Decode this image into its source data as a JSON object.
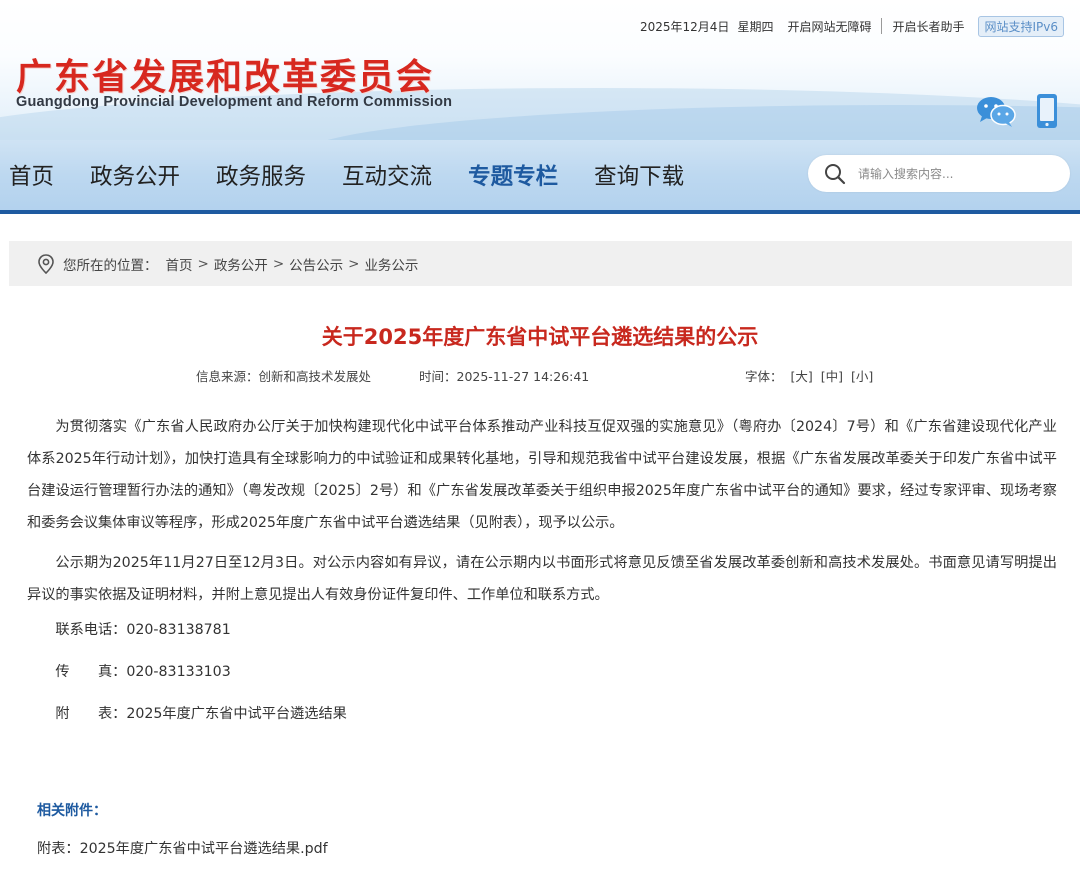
{
  "topbar": {
    "date": "2025年12月4日",
    "weekday": "星期四",
    "accessibility_label": "开启网站无障碍",
    "elder_label": "开启长者助手",
    "ipv6_label": "网站支持IPv6"
  },
  "logo": {
    "cn": "广东省发展和改革委员会",
    "en": "Guangdong Provincial Development and Reform Commission"
  },
  "nav": {
    "items": [
      {
        "label": "首页"
      },
      {
        "label": "政务公开"
      },
      {
        "label": "政务服务"
      },
      {
        "label": "互动交流"
      },
      {
        "label": "专题专栏"
      },
      {
        "label": "查询下载"
      }
    ],
    "active_index": 4
  },
  "search": {
    "placeholder": "请输入搜索内容..."
  },
  "breadcrumb": {
    "label": "您所在的位置：",
    "items": [
      "首页",
      "政务公开",
      "公告公示",
      "业务公示"
    ],
    "separator": ">"
  },
  "article": {
    "title": "关于2025年度广东省中试平台遴选结果的公示",
    "source": "信息来源：创新和高技术发展处",
    "time": "时间：2025-11-27 14:26:41",
    "font_label": "字体：",
    "font_large": "[大]",
    "font_medium": "[中]",
    "font_small": "[小]",
    "paragraphs": [
      "为贯彻落实《广东省人民政府办公厅关于加快构建现代化中试平台体系推动产业科技互促双强的实施意见》（粤府办〔2024〕7号）和《广东省建设现代化产业体系2025年行动计划》，加快打造具有全球影响力的中试验证和成果转化基地，引导和规范我省中试平台建设发展，根据《广东省发展改革委关于印发广东省中试平台建设运行管理暂行办法的通知》（粤发改规〔2025〕2号）和《广东省发展改革委关于组织申报2025年度广东省中试平台的通知》要求，经过专家评审、现场考察和委务会议集体审议等程序，形成2025年度广东省中试平台遴选结果（见附表），现予以公示。",
      "公示期为2025年11月27日至12月3日。对公示内容如有异议，请在公示期内以书面形式将意见反馈至省发展改革委创新和高技术发展处。书面意见请写明提出异议的事实依据及证明材料，并附上意见提出人有效身份证件复印件、工作单位和联系方式。"
    ],
    "phone": "联系电话：020-83138781",
    "fax": "传　　真：020-83133103",
    "appendix": "附　　表：2025年度广东省中试平台遴选结果"
  },
  "attachments": {
    "title": "相关附件：",
    "file": "附表：2025年度广东省中试平台遴选结果.pdf"
  },
  "colors": {
    "brand_red": "#d7281f",
    "title_red": "#c8281e",
    "nav_blue": "#1e5aa0",
    "nav_bg": "#bdd8f0"
  },
  "icons": {
    "wechat": "wechat-icon",
    "mobile": "mobile-icon",
    "search": "search-icon",
    "location": "location-pin-icon"
  }
}
